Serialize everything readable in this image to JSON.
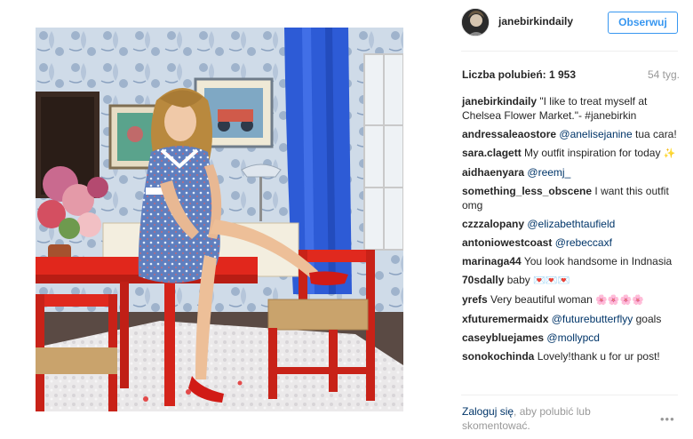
{
  "post": {
    "author": "janebirkindaily",
    "follow_label": "Obserwuj"
  },
  "stats": {
    "likes_label": "Liczba polubień: 1 953",
    "age": "54 tyg."
  },
  "comments": [
    {
      "user": "janebirkindaily",
      "mention": "",
      "text": "\"I like to treat myself at Chelsea Flower Market.\"- #janebirkin",
      "emoji": ""
    },
    {
      "user": "andressaleaostore",
      "mention": "@anelisejanine",
      "text": "tua cara!",
      "emoji": ""
    },
    {
      "user": "sara.clagett",
      "mention": "",
      "text": "My outfit inspiration for today",
      "emoji": "✨"
    },
    {
      "user": "aidhaenyara",
      "mention": "@reemj_",
      "text": "",
      "emoji": ""
    },
    {
      "user": "something_less_obscene",
      "mention": "",
      "text": "I want this outfit omg",
      "emoji": ""
    },
    {
      "user": "czzzalopany",
      "mention": "@elizabethtaufield",
      "text": "",
      "emoji": ""
    },
    {
      "user": "antoniowestcoast",
      "mention": "@rebeccaxf",
      "text": "",
      "emoji": ""
    },
    {
      "user": "marinaga44",
      "mention": "",
      "text": "You look handsome in Indnasia",
      "emoji": ""
    },
    {
      "user": "70sdally",
      "mention": "",
      "text": "baby",
      "emoji": "💌💌💌"
    },
    {
      "user": "yrefs",
      "mention": "",
      "text": "Very beautiful woman",
      "emoji": "🌸🌸🌸🌸"
    },
    {
      "user": "xfuturemermaidx",
      "mention": "@futurebutterflyy",
      "text": "goals",
      "emoji": ""
    },
    {
      "user": "caseybluejames",
      "mention": "@mollypcd",
      "text": "",
      "emoji": ""
    },
    {
      "user": "sonokochinda",
      "mention": "",
      "text": "Lovely!thank u for ur post!",
      "emoji": ""
    }
  ],
  "footer": {
    "login_link": "Zaloguj się",
    "login_rest": ", aby polubić lub skomentować.",
    "more": "•••"
  },
  "icons": {
    "avatar": "profile-avatar",
    "more": "more-options-icon"
  }
}
